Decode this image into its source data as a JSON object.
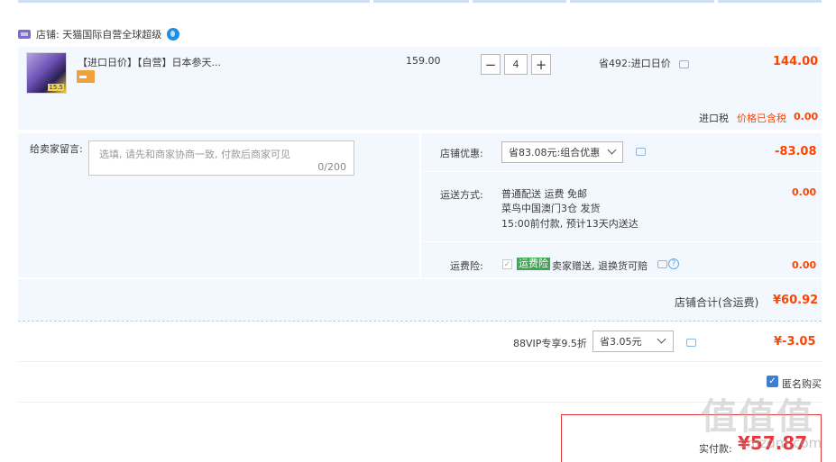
{
  "shop": {
    "label": "店铺: 天猫国际自营全球超级"
  },
  "item": {
    "title": "【进口日价】【自营】日本参天...",
    "thumb_badge": "15.5",
    "unit_price": "159.00",
    "quantity": "4",
    "qty_minus": "−",
    "qty_plus": "+",
    "save_text": "省492:进口日价",
    "subtotal": "144.00",
    "tax_label": "进口税",
    "tax_included": "价格已含税",
    "tax_value": "0.00"
  },
  "message": {
    "label": "给卖家留言:",
    "placeholder": "选填, 请先和商家协商一致, 付款后商家可见",
    "count": "0/200"
  },
  "coupon": {
    "label": "店铺优惠:",
    "selected": "省83.08元:组合优惠",
    "value": "-83.08"
  },
  "shipping": {
    "label": "运送方式:",
    "line1": "普通配送 运费 免邮",
    "line2": "菜鸟中国澳门3仓  发货",
    "line3": "15:00前付款, 预计13天内送达",
    "value": "0.00"
  },
  "insurance": {
    "label": "运费险:",
    "check": "✓",
    "tag": "运费险",
    "text": "卖家赠送, 退换货可赔",
    "help": "?",
    "value": "0.00"
  },
  "shop_total": {
    "label": "店铺合计(含运费)",
    "value": "¥60.92"
  },
  "vip": {
    "label": "88VIP专享9.5折",
    "selected": "省3.05元",
    "value": "¥-3.05"
  },
  "anonymous": {
    "check": "✓",
    "label": "匿名购买"
  },
  "pay": {
    "label": "实付款:",
    "value": "¥57.87"
  },
  "watermark": {
    "logo": "值值值",
    "site": "smzdm.com"
  },
  "colors": {
    "price": "#ff4400",
    "accent": "#3b7fd4",
    "panel": "#f3f8fe"
  }
}
